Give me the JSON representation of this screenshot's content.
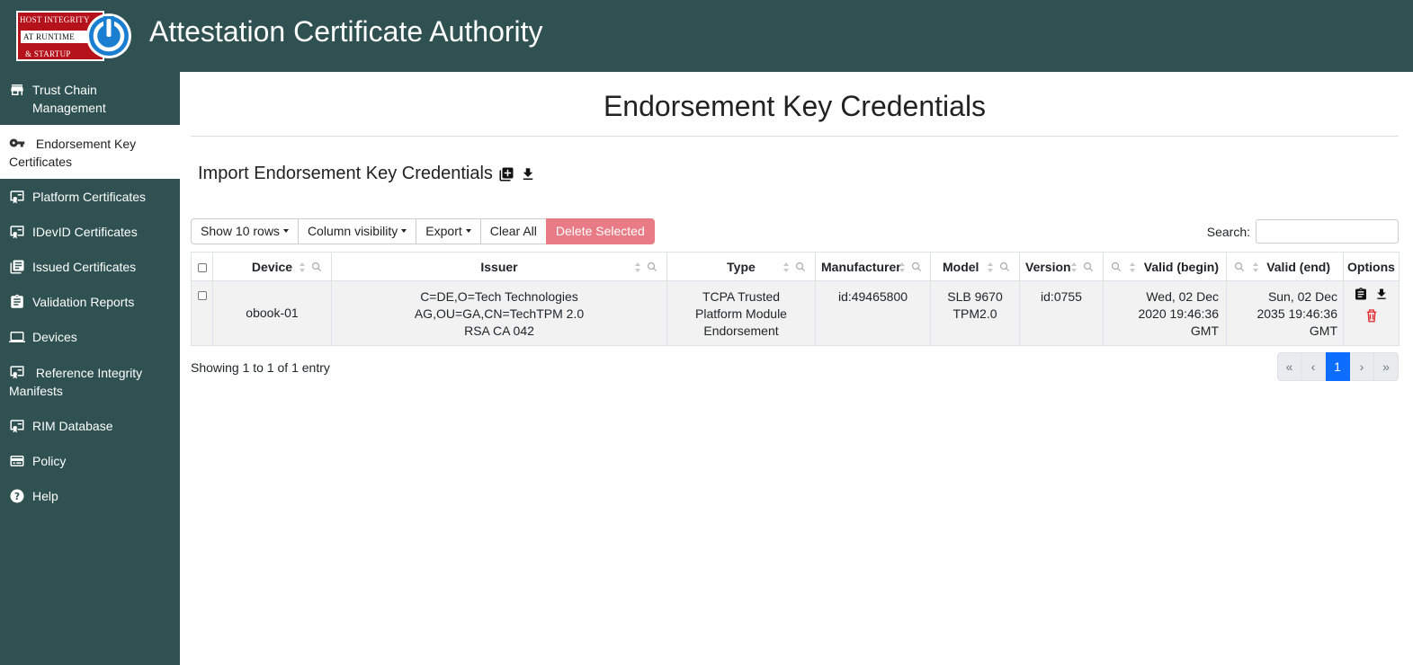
{
  "header": {
    "logo_lines": [
      "HOST INTEGRITY",
      "AT RUNTIME",
      "& STARTUP"
    ],
    "title": "Attestation Certificate Authority"
  },
  "sidebar": {
    "items": [
      {
        "label": "Trust Chain Management",
        "icon": "store-icon"
      },
      {
        "label": "Endorsement Key Certificates",
        "icon": "key-icon",
        "active": true
      },
      {
        "label": "Platform Certificates",
        "icon": "certificate-icon"
      },
      {
        "label": "IDevID Certificates",
        "icon": "certificate-icon"
      },
      {
        "label": "Issued Certificates",
        "icon": "library-books-icon"
      },
      {
        "label": "Validation Reports",
        "icon": "clipboard-icon"
      },
      {
        "label": "Devices",
        "icon": "laptop-icon"
      },
      {
        "label": "Reference Integrity Manifests",
        "icon": "certificate-icon"
      },
      {
        "label": "RIM Database",
        "icon": "certificate-icon"
      },
      {
        "label": "Policy",
        "icon": "policy-card-icon"
      },
      {
        "label": "Help",
        "icon": "help-icon"
      }
    ]
  },
  "main": {
    "page_title": "Endorsement Key Credentials",
    "import_label": "Import Endorsement Key Credentials",
    "toolbar": {
      "show_rows": "Show 10 rows",
      "column_visibility": "Column visibility",
      "export": "Export",
      "clear_all": "Clear All",
      "delete_selected": "Delete Selected"
    },
    "search_label": "Search:",
    "search_value": "",
    "columns": [
      "Device",
      "Issuer",
      "Type",
      "Manufacturer",
      "Model",
      "Version",
      "Valid (begin)",
      "Valid (end)",
      "Options"
    ],
    "rows": [
      {
        "device": "obook-01",
        "issuer": "C=DE,O=Tech Technologies AG,OU=GA,CN=TechTPM 2.0 RSA CA 042",
        "type": "TCPA Trusted Platform Module Endorsement",
        "manufacturer": "id:49465800",
        "model": "SLB 9670 TPM2.0",
        "version": "id:0755",
        "valid_begin": "Wed, 02 Dec 2020 19:46:36 GMT",
        "valid_end": "Sun, 02 Dec 2035 19:46:36 GMT"
      }
    ],
    "showing": "Showing 1 to 1 of 1 entry",
    "pagination": {
      "first": "«",
      "prev": "‹",
      "current": "1",
      "next": "›",
      "last": "»"
    }
  },
  "colors": {
    "header_bg": "#2f5151",
    "sidebar_bg": "#2f5151",
    "delete_btn": "#e87b85",
    "page_active": "#0d6efd",
    "trash": "#e0262b"
  }
}
